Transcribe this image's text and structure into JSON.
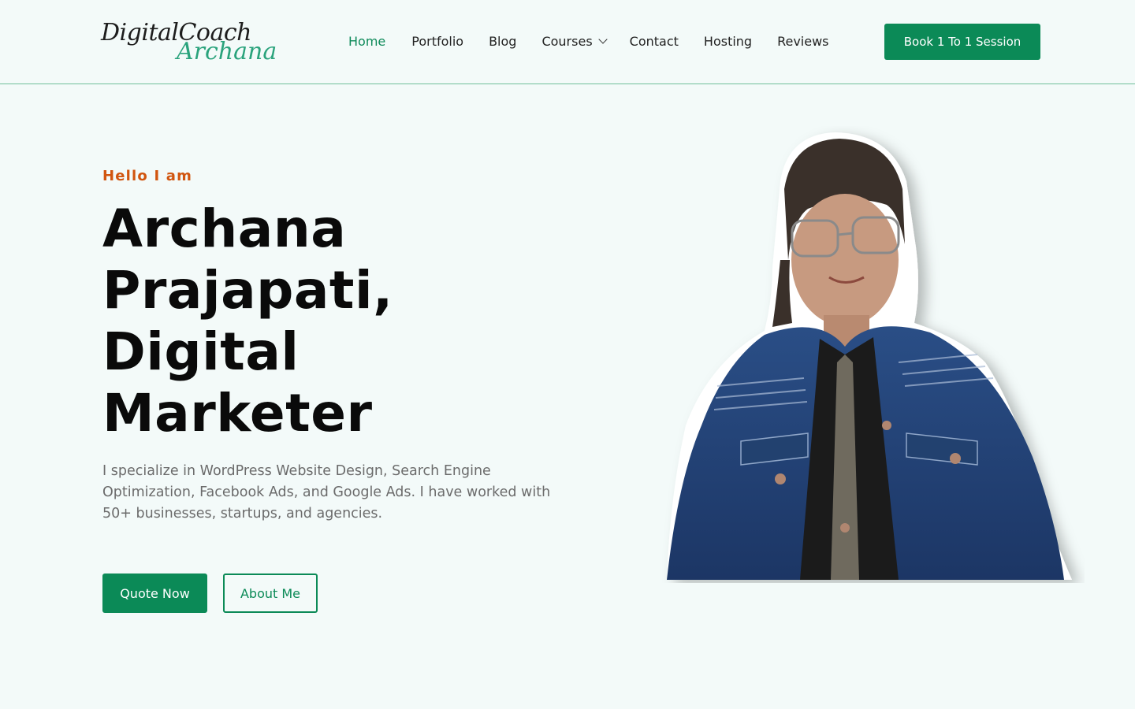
{
  "header": {
    "logo": {
      "line1": "DigitalCoach",
      "line2": "Archana"
    },
    "nav": [
      {
        "label": "Home",
        "active": true
      },
      {
        "label": "Portfolio",
        "active": false
      },
      {
        "label": "Blog",
        "active": false
      },
      {
        "label": "Courses",
        "active": false,
        "has_dropdown": true
      },
      {
        "label": "Contact",
        "active": false
      },
      {
        "label": "Hosting",
        "active": false
      },
      {
        "label": "Reviews",
        "active": false
      }
    ],
    "cta_label": "Book 1 To 1 Session"
  },
  "hero": {
    "eyebrow": "Hello I am",
    "title_lines": [
      "Archana",
      "Prajapati,",
      "Digital",
      "Marketer"
    ],
    "description": "I specialize in WordPress Website Design, Search Engine Optimization, Facebook Ads, and Google Ads. I have worked with 50+ businesses, startups, and agencies.",
    "buttons": {
      "primary": "Quote Now",
      "secondary": "About Me"
    },
    "image": "portrait-photo"
  },
  "colors": {
    "background": "#f3faf9",
    "accent": "#0b8a57",
    "eyebrow": "#d1550f",
    "logo_accent": "#2aa37c"
  }
}
